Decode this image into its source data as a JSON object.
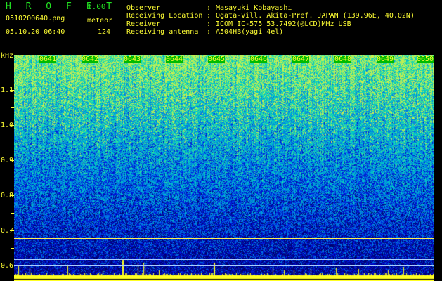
{
  "header": {
    "brand": "H R O F F T",
    "version": "1.00",
    "filename": "0510200640.png",
    "mode": "meteor",
    "datetime": "05.10.20 06:40",
    "count": "124",
    "fields": [
      {
        "label": "Observer",
        "value": "Masayuki Kobayashi"
      },
      {
        "label": "Receiving Location",
        "value": "Ogata-vill. Akita-Pref. JAPAN (139.96E, 40.02N)"
      },
      {
        "label": "Receiver",
        "value": "ICOM IC-575 53.7492(@LCD)MHz USB"
      },
      {
        "label": "Receiving antenna",
        "value": "A504HB(yagi 4el)"
      }
    ]
  },
  "axis": {
    "unit": "kHz",
    "y_labels": [
      "1.1",
      "1.0",
      "0.9",
      "0.8",
      "0.7",
      "0.6"
    ],
    "time_labels": [
      "0641",
      "0642",
      "0643",
      "0644",
      "0645",
      "0646",
      "0647",
      "0648",
      "0649",
      "0650"
    ]
  },
  "colors": {
    "accent_green": "#22e022",
    "text_yellow": "#ffff33",
    "background": "#000000"
  }
}
